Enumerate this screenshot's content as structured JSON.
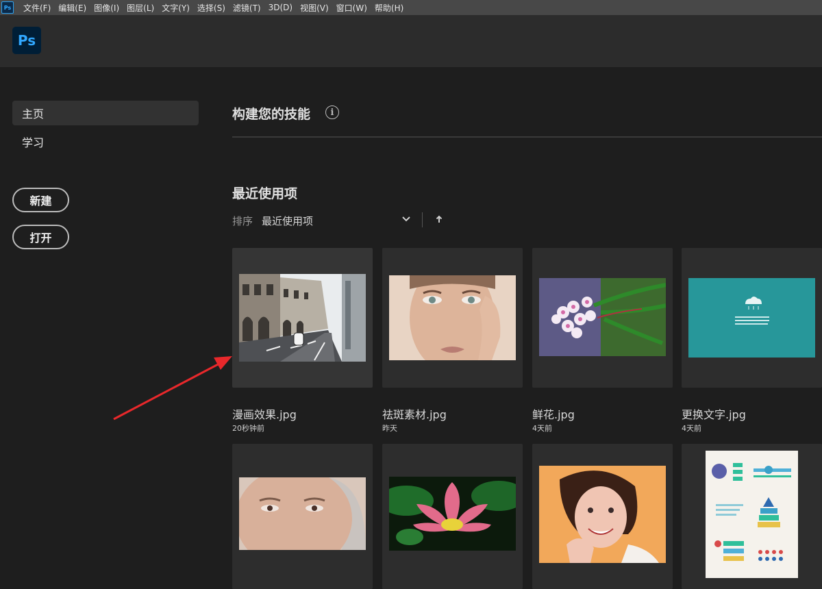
{
  "menubar": {
    "app_icon": "Ps",
    "items": [
      "文件(F)",
      "编辑(E)",
      "图像(I)",
      "图层(L)",
      "文字(Y)",
      "选择(S)",
      "滤镜(T)",
      "3D(D)",
      "视图(V)",
      "窗口(W)",
      "帮助(H)"
    ]
  },
  "header": {
    "logo": "Ps"
  },
  "sidebar": {
    "nav": [
      {
        "label": "主页"
      },
      {
        "label": "学习"
      }
    ],
    "new_label": "新建",
    "open_label": "打开"
  },
  "main": {
    "skills_title": "构建您的技能",
    "info_icon": "i",
    "recent_title": "最近使用项",
    "sort": {
      "label": "排序",
      "value": "最近使用项"
    },
    "recent": [
      {
        "name": "漫画效果.jpg",
        "time": "20秒钟前"
      },
      {
        "name": "祛斑素材.jpg",
        "time": "昨天"
      },
      {
        "name": "鲜花.jpg",
        "time": "4天前"
      },
      {
        "name": "更换文字.jpg",
        "time": "4天前"
      },
      {
        "name": "",
        "time": ""
      },
      {
        "name": "",
        "time": ""
      },
      {
        "name": "",
        "time": ""
      },
      {
        "name": "",
        "time": ""
      }
    ]
  },
  "colors": {
    "accent": "#31a8ff",
    "annotation_arrow": "#e8282b",
    "background": "#1e1e1e"
  }
}
